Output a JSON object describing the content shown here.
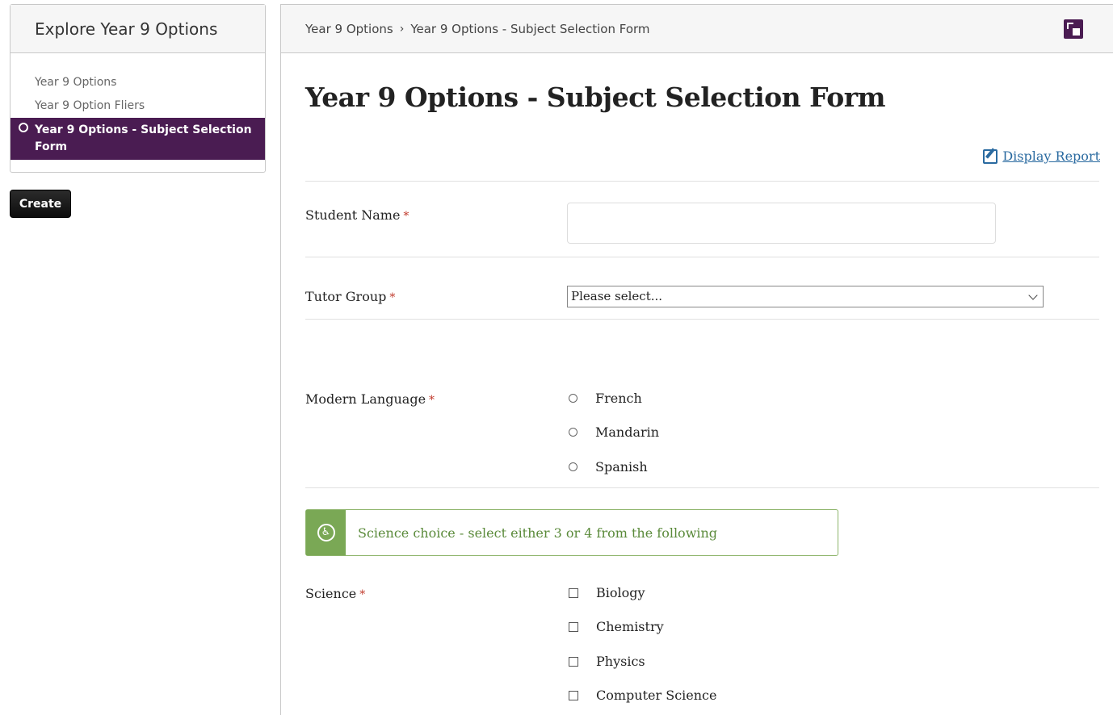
{
  "sidebar": {
    "title": "Explore Year 9 Options",
    "items": [
      {
        "label": "Year 9 Options"
      },
      {
        "label": "Year 9 Option Fliers"
      },
      {
        "label": "Year 9 Options - Subject Selection Form"
      }
    ],
    "create_label": "Create"
  },
  "breadcrumb": {
    "parent": "Year 9 Options",
    "separator": "›",
    "current": "Year 9 Options - Subject Selection Form"
  },
  "page": {
    "title": "Year 9 Options - Subject Selection Form",
    "report_link": "Display Report"
  },
  "form": {
    "required_marker": "*",
    "student_name": {
      "label": "Student Name",
      "value": ""
    },
    "tutor_group": {
      "label": "Tutor Group",
      "selected": "Please select..."
    },
    "modern_language": {
      "label": "Modern Language",
      "options": [
        "French",
        "Mandarin",
        "Spanish"
      ]
    },
    "science_notice": "Science choice - select either 3 or 4 from the following",
    "science": {
      "label": "Science",
      "options": [
        "Biology",
        "Chemistry",
        "Physics",
        "Computer Science"
      ]
    }
  },
  "colors": {
    "accent": "#4a1c52",
    "link": "#2a6aa0",
    "notice": "#7aa855",
    "required": "#c0392b"
  }
}
